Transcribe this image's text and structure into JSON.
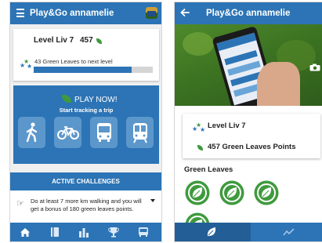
{
  "colors": {
    "primary": "#2c74b5",
    "button_tile": "#5c97cc",
    "leaf_green": "#3f9a3e",
    "progress_track": "#d5d5d5",
    "badge_green": "#3f9a3e"
  },
  "left_screen": {
    "app_bar": {
      "title": "Play&Go annamelie",
      "menu_icon": "hamburger-icon",
      "app_icon": "bus-thumbnail-icon"
    },
    "level_card": {
      "level_label": "Level Liv 7",
      "points": "457",
      "next_level_text": "43 Green Leaves to next level",
      "progress": 0.82
    },
    "play_panel": {
      "play_label": "PLAY NOW!",
      "subtitle": "Start tracking a trip",
      "modes": [
        {
          "icon": "walk-icon"
        },
        {
          "icon": "bike-icon"
        },
        {
          "icon": "bus-icon"
        },
        {
          "icon": "train-icon"
        }
      ]
    },
    "challenges": {
      "header": "ACTIVE CHALLENGES",
      "items": [
        {
          "text": "Do at least 7 more km walking and you will get a bonus of 180 green leaves points.",
          "icon": "pointing-hand-icon"
        }
      ]
    },
    "bottom_nav": [
      {
        "icon": "home-icon",
        "active": true
      },
      {
        "icon": "diary-icon"
      },
      {
        "icon": "stats-icon"
      },
      {
        "icon": "trophy-icon"
      },
      {
        "icon": "bus-icon"
      }
    ]
  },
  "right_screen": {
    "app_bar": {
      "title": "Play&Go annamelie",
      "back_icon": "back-arrow-icon"
    },
    "info_card": {
      "level_label": "Level Liv 7",
      "points_label": "457 Green Leaves Points"
    },
    "badges_section": {
      "heading": "Green Leaves",
      "badge_count": 4
    },
    "bottom_nav": [
      {
        "icon": "leaf-icon",
        "active": true
      },
      {
        "icon": "trend-chart-icon"
      }
    ]
  }
}
